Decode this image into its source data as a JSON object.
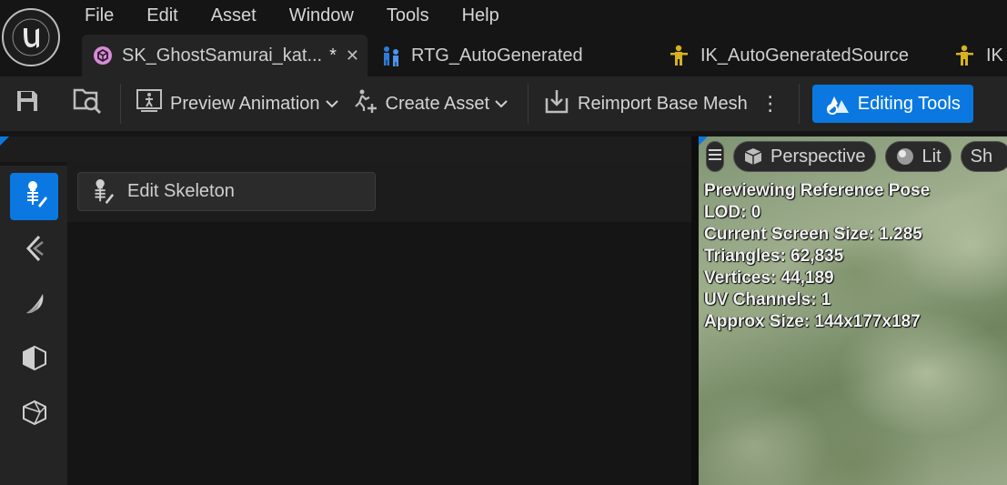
{
  "menu": [
    "File",
    "Edit",
    "Asset",
    "Window",
    "Tools",
    "Help"
  ],
  "tabs": [
    {
      "label": "SK_GhostSamurai_kat...",
      "dirty": "*",
      "close": "✕",
      "icon": "skeletal-mesh-icon",
      "active": true
    },
    {
      "label": "RTG_AutoGenerated",
      "icon": "retargeter-icon",
      "active": false
    },
    {
      "label": "IK_AutoGeneratedSource",
      "icon": "ik-rig-icon",
      "active": false
    },
    {
      "label": "IK",
      "icon": "ik-rig-icon",
      "active": false
    }
  ],
  "toolbar": {
    "save_icon": "save-icon",
    "browse_icon": "browse-folder-icon",
    "preview_animation": "Preview Animation",
    "create_asset": "Create Asset",
    "reimport": "Reimport Base Mesh",
    "more": "⋮",
    "editing_tools": "Editing Tools"
  },
  "left_tools": [
    "skeleton-edit-icon",
    "angle-bracket-icon",
    "crescent-icon",
    "cube-half-icon",
    "wireframe-cube-icon"
  ],
  "content": {
    "edit_skeleton": "Edit Skeleton"
  },
  "viewport": {
    "menu_icon": "hamburger-icon",
    "perspective": "Perspective",
    "lit": "Lit",
    "show": "Sh",
    "stats": [
      "Previewing Reference Pose",
      "LOD: 0",
      "Current Screen Size: 1.285",
      "Triangles: 62,835",
      "Vertices: 44,189",
      "UV Channels: 1",
      "Approx Size: 144x177x187"
    ]
  },
  "colors": {
    "accent": "#0a78e0",
    "ik_icon": "#d7b21e",
    "rtg_icon": "#2f7bd6",
    "mesh_icon": "#d78bd8"
  }
}
